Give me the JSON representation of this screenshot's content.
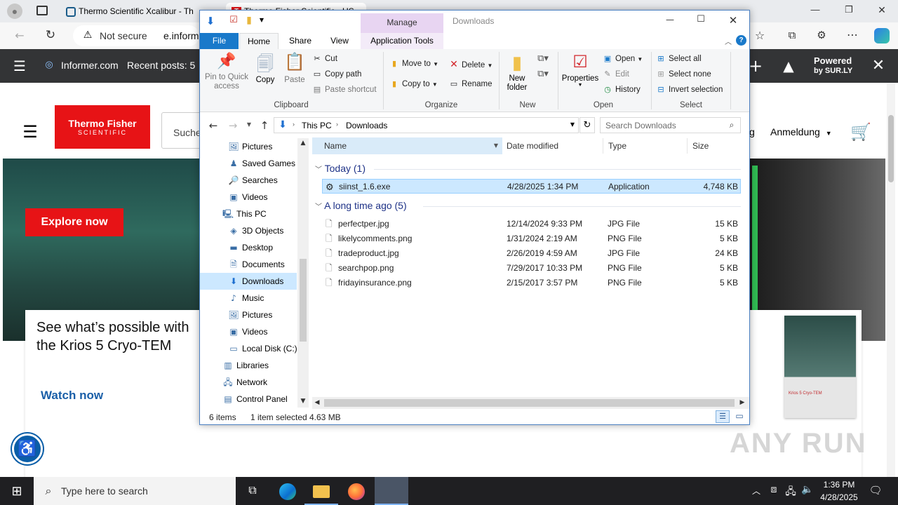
{
  "browser": {
    "tabs": [
      {
        "title": "Thermo Scientific Xcalibur - Th"
      },
      {
        "title": "Thermo Fisher Scientific - US"
      }
    ],
    "address": {
      "security": "Not secure",
      "url": "e.inform"
    },
    "window_controls": {
      "min": "—",
      "max": "❐",
      "close": "✕"
    }
  },
  "informer": {
    "site": "Informer.com",
    "recent": "Recent posts: 5",
    "powered_line1": "Powered",
    "powered_line2": "by SUR.LY"
  },
  "website": {
    "logo_line1": "Thermo Fisher",
    "logo_line2": "SCIENTIFIC",
    "search_placeholder": "Suche",
    "nav_fragment": "g",
    "login": "Anmeldung",
    "explore_button": "Explore now",
    "headline": "See what’s possible with the Krios 5 Cryo-TEM",
    "watch_link": "Watch now",
    "brochure_title": "Krios 5 Cryo-TEM",
    "watermark": "ANY RUN"
  },
  "explorer": {
    "qat_title": "Downloads",
    "manage": "Manage",
    "tabs": [
      "File",
      "Home",
      "Share",
      "View",
      "Application Tools"
    ],
    "clipboard": {
      "pin": "Pin to Quick access",
      "copy": "Copy",
      "paste": "Paste",
      "cut": "Cut",
      "copy_path": "Copy path",
      "paste_shortcut": "Paste shortcut",
      "label": "Clipboard"
    },
    "organize": {
      "move_to": "Move to",
      "copy_to": "Copy to",
      "delete": "Delete",
      "rename": "Rename",
      "label": "Organize"
    },
    "new": {
      "new_folder": "New folder",
      "label": "New"
    },
    "open": {
      "properties": "Properties",
      "open": "Open",
      "edit": "Edit",
      "history": "History",
      "label": "Open"
    },
    "select": {
      "select_all": "Select all",
      "select_none": "Select none",
      "invert": "Invert selection",
      "label": "Select"
    },
    "breadcrumb": [
      "This PC",
      "Downloads"
    ],
    "search_placeholder": "Search Downloads",
    "nav": [
      {
        "label": "Pictures",
        "icon": "pictures-icon",
        "glyph": "🖼",
        "indent": 2
      },
      {
        "label": "Saved Games",
        "icon": "saved-games-icon",
        "glyph": "♟",
        "indent": 2
      },
      {
        "label": "Searches",
        "icon": "searches-icon",
        "glyph": "🔎",
        "indent": 2
      },
      {
        "label": "Videos",
        "icon": "videos-icon",
        "glyph": "▣",
        "indent": 2
      },
      {
        "label": "This PC",
        "icon": "this-pc-icon",
        "glyph": "🖳",
        "indent": 1
      },
      {
        "label": "3D Objects",
        "icon": "3d-objects-icon",
        "glyph": "◈",
        "indent": 2
      },
      {
        "label": "Desktop",
        "icon": "desktop-icon",
        "glyph": "▬",
        "indent": 2
      },
      {
        "label": "Documents",
        "icon": "documents-icon",
        "glyph": "🗎",
        "indent": 2
      },
      {
        "label": "Downloads",
        "icon": "downloads-icon",
        "glyph": "⬇",
        "indent": 2
      },
      {
        "label": "Music",
        "icon": "music-icon",
        "glyph": "♪",
        "indent": 2
      },
      {
        "label": "Pictures",
        "icon": "pictures-icon",
        "glyph": "🖼",
        "indent": 2
      },
      {
        "label": "Videos",
        "icon": "videos-icon",
        "glyph": "▣",
        "indent": 2
      },
      {
        "label": "Local Disk (C:)",
        "icon": "local-disk-icon",
        "glyph": "▭",
        "indent": 2
      },
      {
        "label": "Libraries",
        "icon": "libraries-icon",
        "glyph": "▥",
        "indent": 1
      },
      {
        "label": "Network",
        "icon": "network-icon",
        "glyph": "🖧",
        "indent": 1
      },
      {
        "label": "Control Panel",
        "icon": "control-panel-icon",
        "glyph": "▤",
        "indent": 1
      }
    ],
    "columns": [
      "Name",
      "Date modified",
      "Type",
      "Size"
    ],
    "groups": [
      {
        "title": "Today (1)",
        "files": [
          {
            "name": "siinst_1.6.exe",
            "date": "4/28/2025 1:34 PM",
            "type": "Application",
            "size": "4,748 KB"
          }
        ]
      },
      {
        "title": "A long time ago (5)",
        "files": [
          {
            "name": "perfectper.jpg",
            "date": "12/14/2024 9:33 PM",
            "type": "JPG File",
            "size": "15 KB"
          },
          {
            "name": "likelycomments.png",
            "date": "1/31/2024 2:19 AM",
            "type": "PNG File",
            "size": "5 KB"
          },
          {
            "name": "tradeproduct.jpg",
            "date": "2/26/2019 4:59 AM",
            "type": "JPG File",
            "size": "24 KB"
          },
          {
            "name": "searchpop.png",
            "date": "7/29/2017 10:33 PM",
            "type": "PNG File",
            "size": "5 KB"
          },
          {
            "name": "fridayinsurance.png",
            "date": "2/15/2017 3:57 PM",
            "type": "PNG File",
            "size": "5 KB"
          }
        ]
      }
    ],
    "status": {
      "count": "6 items",
      "selected": "1 item selected",
      "size": "4.63 MB"
    }
  },
  "taskbar": {
    "search_placeholder": "Type here to search",
    "time": "1:36 PM",
    "date": "4/28/2025"
  },
  "colors": {
    "accent": "#0063b1",
    "brand_red": "#e71316",
    "selection": "#cce8ff",
    "manage_tab": "#e8d5f2"
  }
}
